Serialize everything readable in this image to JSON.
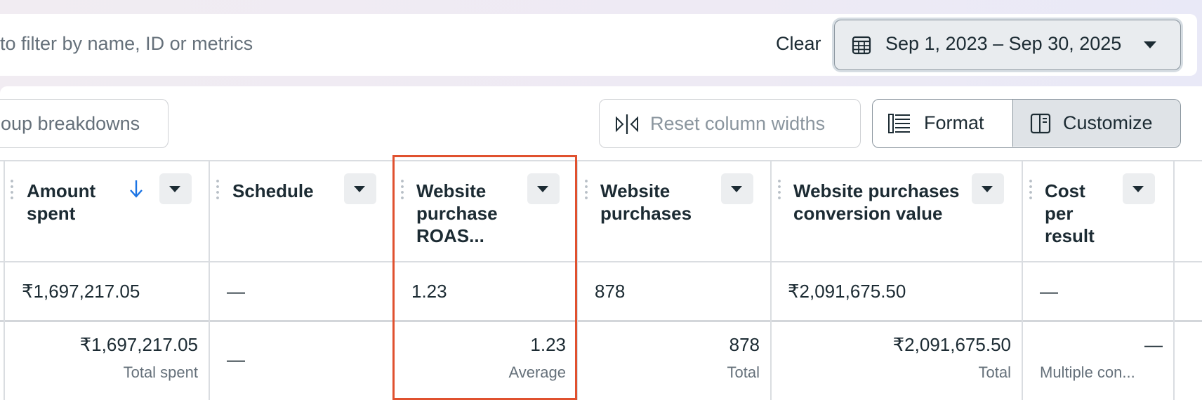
{
  "filter_bar": {
    "search_placeholder": "to filter by name, ID or metrics",
    "clear_label": "Clear",
    "date_range": "Sep 1, 2023 – Sep 30, 2025"
  },
  "toolbar": {
    "group_breakdowns_label": "oup breakdowns",
    "reset_column_widths_label": "Reset column widths",
    "format_label": "Format",
    "customize_label": "Customize"
  },
  "columns": [
    {
      "title": "Amount spent",
      "sorted": "descending",
      "value": "₹1,697,217.05",
      "total_value": "₹1,697,217.05",
      "total_label": "Total spent"
    },
    {
      "title": "Schedule",
      "value": "—",
      "total_value": "—",
      "total_label": ""
    },
    {
      "title": "Website purchase ROAS...",
      "value": "1.23",
      "total_value": "1.23",
      "total_label": "Average",
      "highlighted": true
    },
    {
      "title": "Website purchases",
      "value": "878",
      "total_value": "878",
      "total_label": "Total"
    },
    {
      "title": "Website purchases conversion value",
      "value": "₹2,091,675.50",
      "total_value": "₹2,091,675.50",
      "total_label": "Total"
    },
    {
      "title": "Cost per result",
      "value": "—",
      "total_value": "—",
      "total_label": "Multiple con..."
    }
  ],
  "colors": {
    "highlight": "#e0512f",
    "sort_arrow": "#1b74e4",
    "text": "#1c2b33",
    "muted": "#65707a"
  },
  "icons": [
    "calendar-icon",
    "dropdown-caret-icon",
    "reset-column-widths-icon",
    "format-icon",
    "customize-icon",
    "sort-descending-icon",
    "drag-handle-icon",
    "column-menu-caret-icon"
  ]
}
